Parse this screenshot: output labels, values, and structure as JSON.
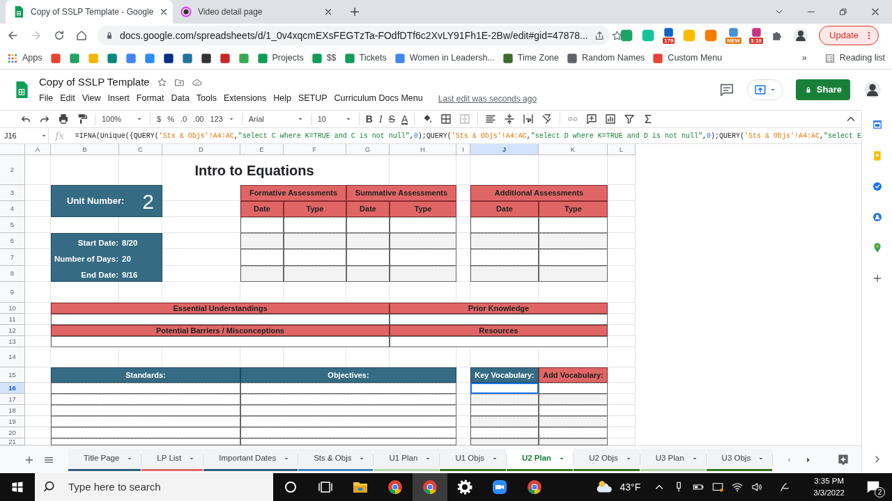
{
  "browser": {
    "tabs": [
      {
        "title": "Copy of SSLP Template - Google",
        "kind": "sheets",
        "selected": true
      },
      {
        "title": "Video detail page",
        "kind": "video",
        "selected": false
      }
    ],
    "url": "docs.google.com/spreadsheets/d/1_0v4xqcmEXsFEGTzTa-FOdfDTf6c2XvLY91Fh1E-2Bw/edit#gid=47878...",
    "extensions": [
      {
        "color": "#1da462"
      },
      {
        "color": "#15c39a"
      },
      {
        "color": "#0a66c2",
        "badge": {
          "text": "179",
          "color": "#d93025"
        }
      },
      {
        "color": "#fbbc04"
      },
      {
        "color": "#f57c00"
      },
      {
        "color": "#4a90d9",
        "badge": {
          "text": "NEW",
          "color": "#e8710a"
        }
      },
      {
        "color": "#c13584",
        "badge": {
          "text": "3:19",
          "color": "#d93025"
        }
      }
    ],
    "update_button": "Update",
    "bookmarks": [
      {
        "kind": "apps",
        "label": "Apps"
      },
      {
        "color": "#ea4335"
      },
      {
        "color": "#1fa463"
      },
      {
        "color": "#f4b400"
      },
      {
        "color": "#00897b"
      },
      {
        "color": "#4285f4"
      },
      {
        "color": "#2d8cff"
      },
      {
        "color": "#003087"
      },
      {
        "color": "#21759b"
      },
      {
        "color": "#333333"
      },
      {
        "color": "#c62828"
      },
      {
        "color": "#34a853"
      },
      {
        "color": "#0f9d58",
        "label": "Projects"
      },
      {
        "color": "#0f9d58",
        "label": "$$"
      },
      {
        "color": "#0f9d58",
        "label": "Tickets"
      },
      {
        "color": "#4285f4",
        "label": "Women in Leadersh..."
      },
      {
        "color": "#3e6b2f",
        "label": "Time Zone"
      },
      {
        "color": "#5f6368",
        "label": "Random Names"
      },
      {
        "color": "#ea4335",
        "label": "Custom Menu"
      }
    ],
    "bookmarks_overflow": "»",
    "reading_list": "Reading list"
  },
  "sheets": {
    "title": "Copy of SSLP Template",
    "menu": [
      "File",
      "Edit",
      "View",
      "Insert",
      "Format",
      "Data",
      "Tools",
      "Extensions",
      "Help",
      "SETUP",
      "Curriculum Docs Menu"
    ],
    "last_edit": "Last edit was seconds ago",
    "share": "Share",
    "toolbar": {
      "zoom": "100%",
      "currency": "$",
      "percent": "%",
      "decrease_decimal": ".0",
      "increase_decimal": ".00",
      "more_formats": "123",
      "font": "Arial",
      "font_size": "10",
      "text_format": [
        {
          "kind": "bold",
          "text": "B"
        },
        {
          "kind": "italic",
          "text": "I"
        },
        {
          "kind": "strike",
          "text": "S"
        },
        {
          "kind": "color",
          "text": "A"
        }
      ]
    },
    "name_box": "J16",
    "fx": "fx",
    "formula": [
      {
        "text": "=IFNA(Unique({QUERY(",
        "kind": "plain"
      },
      {
        "text": "'Sts & Objs'!A4:AC",
        "kind": "range"
      },
      {
        "text": ",",
        "kind": "plain"
      },
      {
        "text": "\"select C where K=TRUE and C is not null\"",
        "kind": "string"
      },
      {
        "text": ",",
        "kind": "plain"
      },
      {
        "text": "0",
        "kind": "number"
      },
      {
        "text": ");QUERY(",
        "kind": "plain"
      },
      {
        "text": "'Sts & Objs'!A4:AC",
        "kind": "range"
      },
      {
        "text": ",",
        "kind": "plain"
      },
      {
        "text": "\"select D where K=TRUE and D is not null\"",
        "kind": "string"
      },
      {
        "text": ",",
        "kind": "plain"
      },
      {
        "text": "0",
        "kind": "number"
      },
      {
        "text": ");QUERY(",
        "kind": "plain"
      },
      {
        "text": "'Sts & Objs'!A4:AC",
        "kind": "range"
      },
      {
        "text": ",",
        "kind": "plain"
      },
      {
        "text": "\"select E",
        "kind": "string"
      }
    ],
    "columns": [
      {
        "label": "A",
        "selected": false
      },
      {
        "label": "B",
        "selected": false
      },
      {
        "label": "C",
        "selected": false
      },
      {
        "label": "D",
        "selected": false
      },
      {
        "label": "E",
        "selected": false
      },
      {
        "label": "F",
        "selected": false
      },
      {
        "label": "G",
        "selected": false
      },
      {
        "label": "H",
        "selected": false
      },
      {
        "label": "I",
        "selected": false
      },
      {
        "label": "J",
        "selected": true
      },
      {
        "label": "K",
        "selected": false
      },
      {
        "label": "L",
        "selected": false
      }
    ],
    "rows": [
      {
        "label": "2",
        "selected": false
      },
      {
        "label": "3",
        "selected": false
      },
      {
        "label": "4",
        "selected": false
      },
      {
        "label": "5",
        "selected": false
      },
      {
        "label": "6",
        "selected": false
      },
      {
        "label": "7",
        "selected": false
      },
      {
        "label": "8",
        "selected": false
      },
      {
        "label": "9",
        "selected": false
      },
      {
        "label": "10",
        "selected": false
      },
      {
        "label": "11",
        "selected": false
      },
      {
        "label": "12",
        "selected": false
      },
      {
        "label": "13",
        "selected": false
      },
      {
        "label": "14",
        "selected": false
      },
      {
        "label": "15",
        "selected": false
      },
      {
        "label": "16",
        "selected": true
      },
      {
        "label": "17",
        "selected": false
      },
      {
        "label": "18",
        "selected": false
      },
      {
        "label": "19",
        "selected": false
      },
      {
        "label": "20",
        "selected": false
      },
      {
        "label": "21",
        "selected": false
      }
    ],
    "page_title": "Intro to Equations",
    "unit": {
      "label": "Unit Number:",
      "value": "2"
    },
    "schedule": [
      {
        "label": "Start Date:",
        "value": "8/20"
      },
      {
        "label": "Number of Days:",
        "value": "20"
      },
      {
        "label": "End Date:",
        "value": "9/16"
      }
    ],
    "assessments": {
      "groups": [
        "Formative Assessments",
        "Summative Assessments"
      ],
      "subheaders": [
        "Date",
        "Type",
        "Date",
        "Type"
      ]
    },
    "additional": {
      "title": "Additional Assessments",
      "subheaders": [
        "Date",
        "Type"
      ]
    },
    "sections": [
      {
        "left": "Essential Understandings",
        "right": "Prior Knowledge"
      },
      {
        "left": "Potential Barriers / Misconceptions",
        "right": "Resources"
      }
    ],
    "lists": [
      "Standards:",
      "Objectives:"
    ],
    "vocabulary": [
      "Key Vocabulary:",
      "Add Vocabulary:"
    ],
    "sheet_tabs": [
      {
        "label": "Title Page",
        "color": "#2f5f7a",
        "selected": false
      },
      {
        "label": "LP List",
        "color": "#e06666",
        "selected": false
      },
      {
        "label": "Important Dates",
        "color": "#2f5f7a",
        "selected": false
      },
      {
        "label": "Sts & Objs",
        "color": "#3d85c6",
        "selected": false
      },
      {
        "label": "U1 Plan",
        "color": "#b6d7a8",
        "selected": false
      },
      {
        "label": "U1 Objs",
        "color": "#38761d",
        "selected": false
      },
      {
        "label": "U2 Plan",
        "color": "#38761d",
        "selected": true
      },
      {
        "label": "U2 Objs",
        "color": "#38761d",
        "selected": false
      },
      {
        "label": "U3 Plan",
        "color": "#b6d7a8",
        "selected": false
      },
      {
        "label": "U3 Objs",
        "color": "#38761d",
        "selected": false
      }
    ]
  },
  "taskbar": {
    "search_placeholder": "Type here to search",
    "apps": [
      {
        "kind": "cortana",
        "selected": false
      },
      {
        "kind": "taskview",
        "selected": false
      },
      {
        "kind": "files",
        "selected": false
      },
      {
        "kind": "chrome",
        "selected": false
      },
      {
        "kind": "chrome",
        "selected": true
      },
      {
        "kind": "settings",
        "selected": false
      },
      {
        "kind": "zoom",
        "selected": false
      },
      {
        "kind": "chrome",
        "selected": false
      }
    ],
    "weather": "43°F",
    "time": "3:35 PM",
    "date": "3/3/2022",
    "notifications": "2"
  }
}
